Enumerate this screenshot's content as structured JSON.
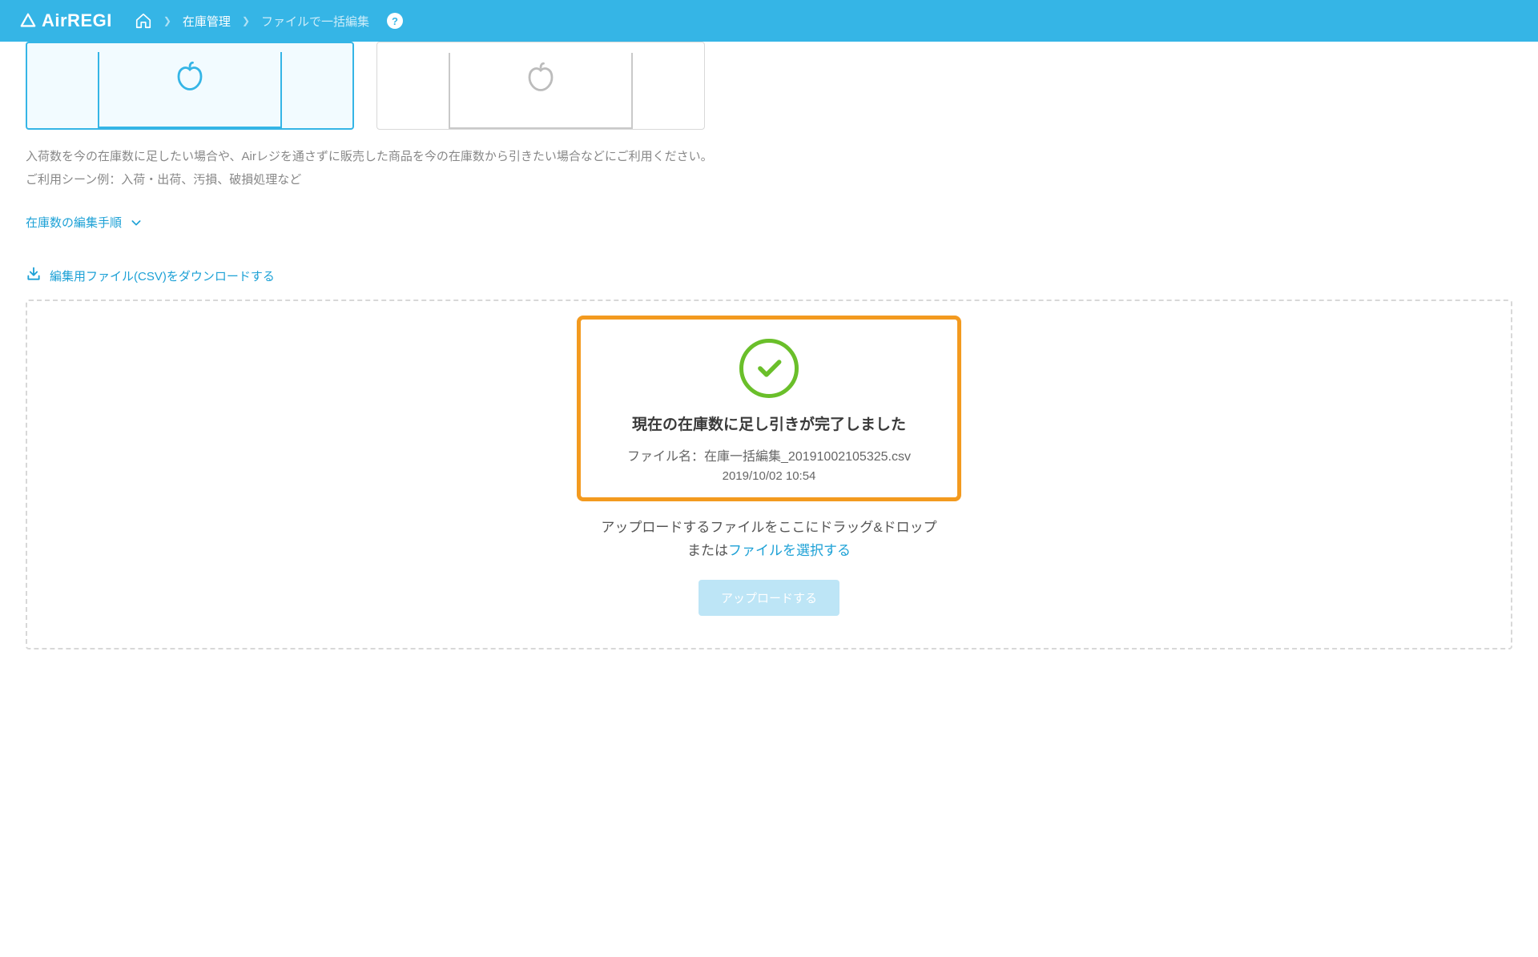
{
  "header": {
    "logo_text": "AirREGI",
    "breadcrumb": {
      "inventory": "在庫管理",
      "current": "ファイルで一括編集",
      "help": "?"
    }
  },
  "description": {
    "line1": "入荷数を今の在庫数に足したい場合や、Airレジを通さずに販売した商品を今の在庫数から引きたい場合などにご利用ください。",
    "line2": "ご利用シーン例：入荷・出荷、汚損、破損処理など"
  },
  "expand_link": "在庫数の編集手順",
  "download_link": "編集用ファイル(CSV)をダウンロードする",
  "success": {
    "title": "現在の在庫数に足し引きが完了しました",
    "filename": "ファイル名：在庫一括編集_20191002105325.csv",
    "timestamp": "2019/10/02 10:54"
  },
  "drop": {
    "instruction": "アップロードするファイルをここにドラッグ&ドロップ",
    "or_prefix": "または",
    "file_select": "ファイルを選択する"
  },
  "upload_button": "アップロードする",
  "colors": {
    "brand": "#35b5e6",
    "accent_orange": "#f39a1f",
    "success_green": "#6abf2a",
    "link": "#1da1d6"
  }
}
